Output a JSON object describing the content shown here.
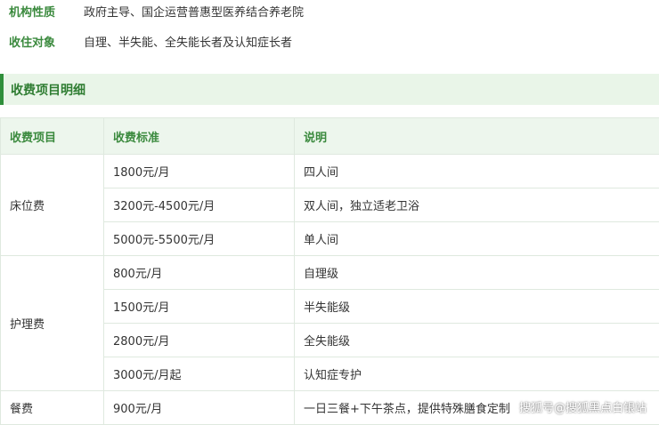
{
  "info": [
    {
      "label": "机构性质",
      "value": "政府主导、国企运营普惠型医养结合养老院"
    },
    {
      "label": "收住对象",
      "value": "自理、半失能、全失能长者及认知症长者"
    }
  ],
  "section": {
    "title": "收费项目明细"
  },
  "table": {
    "headers": [
      "收费项目",
      "收费标准",
      "说明"
    ],
    "categories": [
      "床位费",
      "护理费",
      "餐费"
    ],
    "rows": [
      {
        "price": "1800元/月",
        "desc": "四人间"
      },
      {
        "price": "3200元-4500元/月",
        "desc": "双人间，独立适老卫浴"
      },
      {
        "price": "5000元-5500元/月",
        "desc": "单人间"
      },
      {
        "price": "800元/月",
        "desc": "自理级"
      },
      {
        "price": "1500元/月",
        "desc": "半失能级"
      },
      {
        "price": "2800元/月",
        "desc": "全失能级"
      },
      {
        "price": "3000元/月起",
        "desc": "认知症专护"
      },
      {
        "price": "900元/月",
        "desc": "一日三餐+下午茶点，提供特殊膳食定制"
      }
    ]
  },
  "watermark": "搜狐号@搜狐黑点白银站",
  "colors": {
    "accent": "#2f8f3b",
    "header_bg": "#e9f5e8",
    "label": "#3b8a3e"
  }
}
